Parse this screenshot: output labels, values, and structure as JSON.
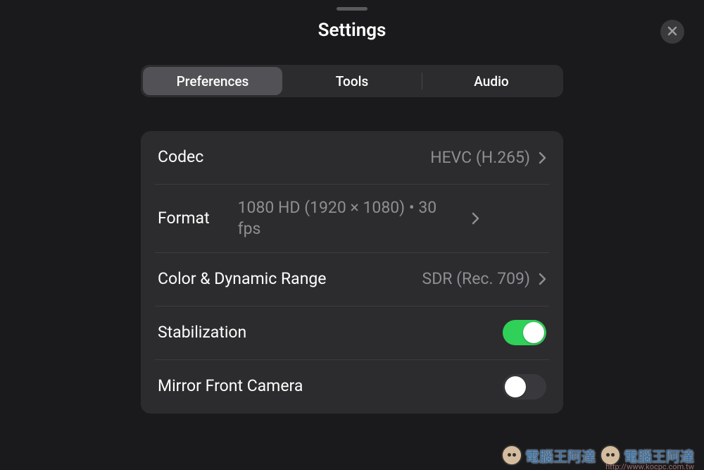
{
  "header": {
    "title": "Settings"
  },
  "tabs": [
    {
      "label": "Preferences",
      "active": true
    },
    {
      "label": "Tools",
      "active": false
    },
    {
      "label": "Audio",
      "active": false
    }
  ],
  "settings": {
    "codec": {
      "label": "Codec",
      "value": "HEVC (H.265)"
    },
    "format": {
      "label": "Format",
      "value": "1080 HD (1920 × 1080) • 30 fps"
    },
    "color": {
      "label": "Color & Dynamic Range",
      "value": "SDR (Rec. 709)"
    },
    "stabilization": {
      "label": "Stabilization",
      "on": true
    },
    "mirror": {
      "label": "Mirror Front Camera",
      "on": false
    }
  },
  "watermark": {
    "text1": "電腦王阿達",
    "text2": "電腦王阿達",
    "url": "http://www.kocpc.com.tw"
  },
  "colors": {
    "toggle_on": "#30d158"
  }
}
